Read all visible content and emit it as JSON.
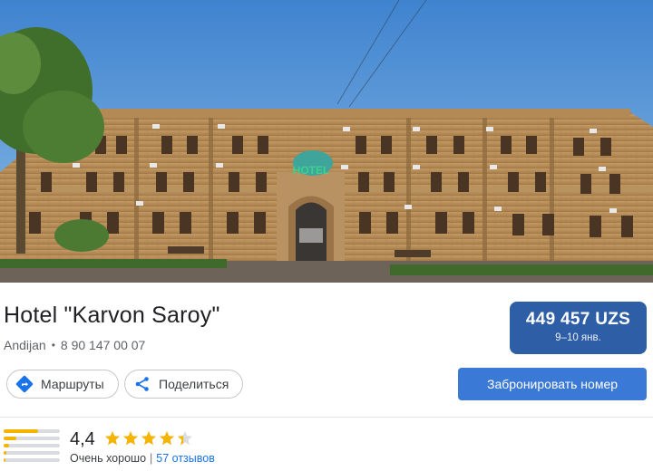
{
  "hotel": {
    "name": "Hotel \"Karvon Saroy\"",
    "city": "Andijan",
    "separator": "•",
    "phone": "8 90 147 00 07",
    "sign_text": "HOTEL"
  },
  "price": {
    "value": "449 457 UZS",
    "dates": "9–10 янв."
  },
  "actions": {
    "routes_label": "Маршруты",
    "share_label": "Поделиться",
    "book_label": "Забронировать номер"
  },
  "rating": {
    "score": "4,4",
    "stars_value": 4.4,
    "max_stars": 5,
    "label": "Очень хорошо",
    "separator": "|",
    "reviews": "57 отзывов",
    "distribution": [
      0.62,
      0.22,
      0.1,
      0.05,
      0.04
    ]
  },
  "colors": {
    "price_bg": "#2e5ea6",
    "book_bg": "#3b79d6",
    "star": "#f4b400",
    "star_empty": "#dadce0",
    "link": "#1a73e8",
    "directions_icon": "#1a73e8"
  },
  "icons": {
    "routes": "directions-icon",
    "share": "share-icon",
    "star": "star-icon"
  }
}
